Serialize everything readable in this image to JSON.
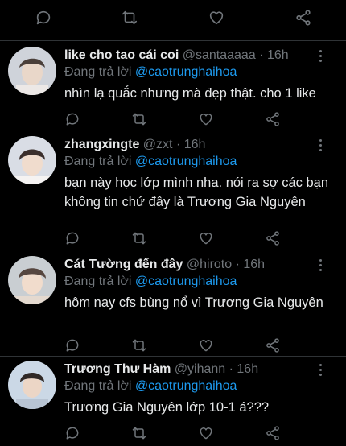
{
  "top_actions": {
    "reply_icon": "comment-icon",
    "retweet_icon": "retweet-icon",
    "like_icon": "heart-icon",
    "share_icon": "share-icon"
  },
  "replies": [
    {
      "name": "like cho tao cái coi",
      "handle": "@santaaaaa",
      "separator": "·",
      "time": "16h",
      "replying_prefix": "Đang trả lời",
      "mention": "@caotrunghaihoa",
      "text": "nhìn lạ quắc nhưng mà đẹp thật. cho 1 like"
    },
    {
      "name": "zhangxingte",
      "handle": "@zxt",
      "separator": "·",
      "time": "16h",
      "replying_prefix": "Đang trả lời",
      "mention": "@caotrunghaihoa",
      "text": "bạn này học lớp mình nha. nói ra sợ các bạn không tin chứ đây là Trương Gia Nguyên"
    },
    {
      "name": "Cát Tường đến đây",
      "handle": "@hiroto",
      "separator": "·",
      "time": "16h",
      "replying_prefix": "Đang trả lời",
      "mention": "@caotrunghaihoa",
      "text": "hôm nay cfs bùng nổ vì Trương Gia Nguyên"
    },
    {
      "name": "Trương Thư Hàm",
      "handle": "@yihann",
      "separator": "·",
      "time": "16h",
      "replying_prefix": "Đang trả lời",
      "mention": "@caotrunghaihoa",
      "text": "Trương Gia Nguyên lớp 10-1 á???"
    }
  ]
}
